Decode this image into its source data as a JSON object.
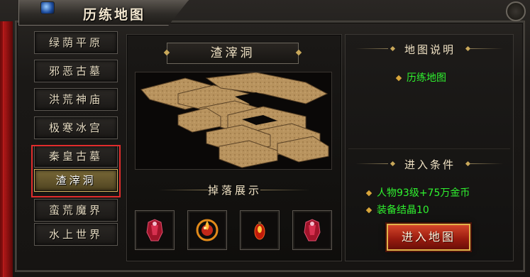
{
  "window": {
    "title": "历练地图"
  },
  "nav": {
    "items": [
      {
        "label": "绿荫平原",
        "active": false
      },
      {
        "label": "邪恶古墓",
        "active": false
      },
      {
        "label": "洪荒神庙",
        "active": false
      },
      {
        "label": "极寒冰宫",
        "active": false
      },
      {
        "label": "秦皇古墓",
        "active": false
      },
      {
        "label": "渣滓洞",
        "active": true
      },
      {
        "label": "蛮荒魔界",
        "active": false
      },
      {
        "label": "水上世界",
        "active": false
      }
    ]
  },
  "center": {
    "map_name": "渣滓洞",
    "drop_title": "掉落展示",
    "drops": [
      {
        "icon": "red-armor-icon"
      },
      {
        "icon": "fire-orb-icon"
      },
      {
        "icon": "red-potion-icon"
      },
      {
        "icon": "red-armor-icon"
      }
    ]
  },
  "right": {
    "desc_title": "地图说明",
    "desc_text": "历练地图",
    "req_title": "进入条件",
    "requirements": [
      "人物93级+75万金币",
      "装备结晶10"
    ],
    "enter_label": "进入地图"
  },
  "colors": {
    "accent": "#c9a85a",
    "green_text": "#2ff22f",
    "highlight": "#e12c2c"
  }
}
